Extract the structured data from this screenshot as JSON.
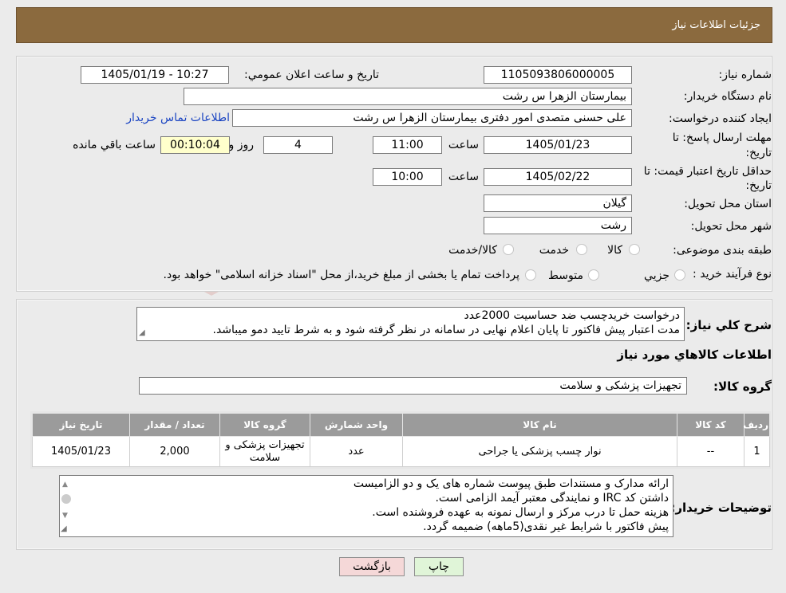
{
  "header": {
    "title": "جزئیات اطلاعات نیاز"
  },
  "watermark": {
    "text": "AriaTender.neT"
  },
  "form": {
    "need_number_label": "شماره نیاز:",
    "need_number": "1105093806000005",
    "announce_label": "تاریخ و ساعت اعلان عمومي:",
    "announce_value": "1405/01/19 - 10:27",
    "buyer_org_label": "نام دستگاه خریدار:",
    "buyer_org": "بیمارستان الزهرا  س  رشت",
    "requester_label": "ایجاد کننده درخواست:",
    "requester": "علی حسنی متصدی امور دفتری بیمارستان الزهرا  س  رشت",
    "contact_link": "اطلاعات تماس خریدار",
    "deadline_label_1": "مهلت ارسال پاسخ: تا",
    "deadline_label_2": "تاریخ:",
    "deadline_date": "1405/01/23",
    "time_label": "ساعت",
    "deadline_time": "11:00",
    "days_value": "4",
    "days_label": "روز و",
    "remaining_value": "00:10:04",
    "remaining_label": "ساعت باقي مانده",
    "validity_label_1": "حداقل تاریخ اعتبار قیمت: تا",
    "validity_label_2": "تاریخ:",
    "validity_date": "1405/02/22",
    "validity_time": "10:00",
    "province_label": "استان محل تحویل:",
    "province": "گیلان",
    "city_label": "شهر محل تحویل:",
    "city": "رشت",
    "category_label": "طبقه بندی موضوعی:",
    "category_options": [
      "کالا",
      "خدمت",
      "کالا/خدمت"
    ],
    "process_label": "نوع فرآیند خرید :",
    "process_options": [
      "جزیي",
      "متوسط"
    ],
    "process_note": "پرداخت تمام یا بخشی از مبلغ خرید،از محل \"اسناد خزانه اسلامی\" خواهد بود."
  },
  "summary": {
    "label": "شرح کلي نیاز:",
    "line1": "درخواست خریدچسب ضد حساسیت 2000عدد",
    "line2": "مدت اعتبار پیش فاکتور تا پایان اعلام نهایی در سامانه در نظر گرفته شود و به شرط تایید دمو میباشد."
  },
  "goods": {
    "section_title": "اطلاعات کالاهاي مورد نیاز",
    "group_label": "گروه کالا:",
    "group_value": "تجهیزات پزشکی و سلامت",
    "columns": [
      "ردیف",
      "کد کالا",
      "نام کالا",
      "واحد شمارش",
      "گروه کالا",
      "تعداد / مقدار",
      "تاریخ نیاز"
    ],
    "rows": [
      [
        "1",
        "--",
        "نوار چسب پزشکی یا جراحی",
        "عدد",
        "تجهیزات پزشکی و سلامت",
        "2,000",
        "1405/01/23"
      ]
    ]
  },
  "buyer_notes": {
    "label": "توضیحات خریدار:",
    "lines": [
      "ارائه مدارک و مستندات طبق پیوست شماره های یک و دو الزامیست",
      "داشتن کد IRC و نمایندگی معتبر آیمد الزامی است.",
      "هزینه حمل تا درب مرکز و ارسال نمونه به عهده فروشنده است.",
      "پیش فاکتور با شرایط غیر نقدی(5ماهه) ضمیمه گردد."
    ]
  },
  "buttons": {
    "print": "چاپ",
    "back": "بازگشت"
  },
  "colors": {
    "header": "#8b6a3e",
    "back_button": "#f5d8d8",
    "print_button": "#e0f5d8",
    "remaining_bg": "#ffffcc",
    "link": "#1a44c2"
  }
}
